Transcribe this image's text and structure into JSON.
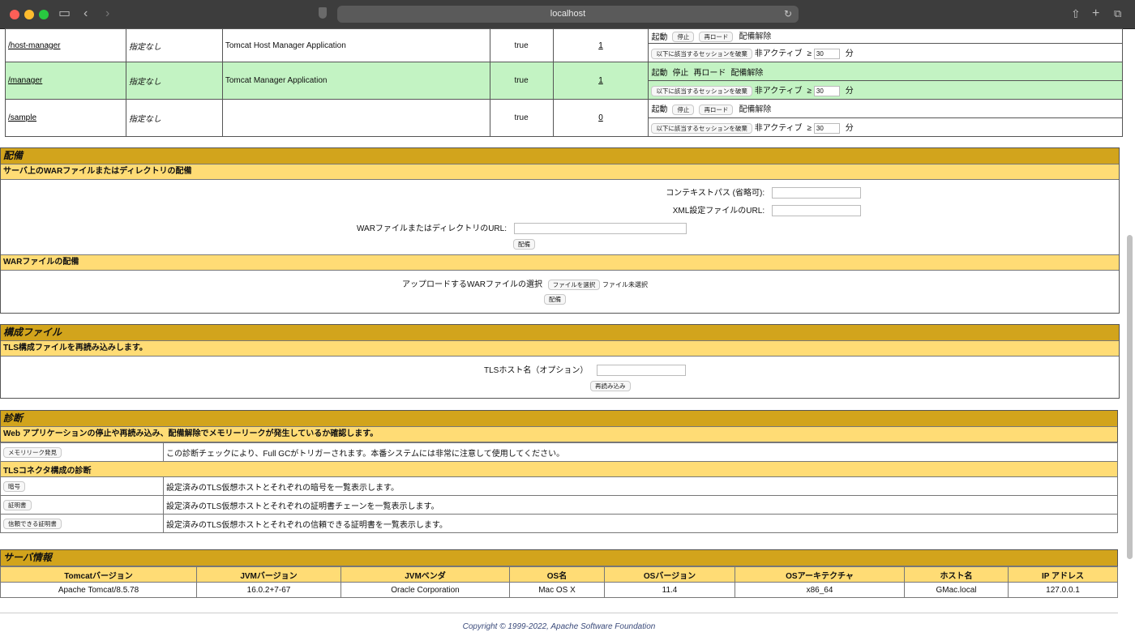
{
  "browser": {
    "address": "localhost"
  },
  "apps": {
    "rows": [
      {
        "path": "/host-manager",
        "version": "指定なし",
        "name": "Tomcat Host Manager Application",
        "running": "true",
        "sessions": "1",
        "highlight": false
      },
      {
        "path": "/manager",
        "version": "指定なし",
        "name": "Tomcat Manager Application",
        "running": "true",
        "sessions": "1",
        "highlight": true
      },
      {
        "path": "/sample",
        "version": "指定なし",
        "name": "",
        "running": "true",
        "sessions": "0",
        "highlight": false
      }
    ],
    "cmd_start": "起動",
    "cmd_stop": "停止",
    "cmd_reload": "再ロード",
    "cmd_undeploy": "配備解除",
    "expire_button": "以下に該当するセッションを破棄",
    "idle_label": "非アクティブ",
    "ge": "≥",
    "idle_value": "30",
    "minutes": "分"
  },
  "deploy": {
    "title": "配備",
    "server_subtitle": "サーバ上のWARファイルまたはディレクトリの配備",
    "context_path_label": "コンテキストパス (省略可):",
    "xml_url_label": "XML設定ファイルのURL:",
    "war_url_label": "WARファイルまたはディレクトリのURL:",
    "deploy_button": "配備",
    "war_subtitle": "WARファイルの配備",
    "upload_label": "アップロードするWARファイルの選択",
    "choose_file_button": "ファイルを選択",
    "no_file": "ファイル未選択",
    "upload_deploy_button": "配備"
  },
  "config": {
    "title": "構成ファイル",
    "subtitle": "TLS構成ファイルを再読み込みします。",
    "host_label": "TLSホスト名（オプション）",
    "reload_button": "再読み込み"
  },
  "diagnostics": {
    "title": "診断",
    "subtitle": "Web アプリケーションの停止や再読み込み、配備解除でメモリーリークが発生しているか確認します。",
    "leak_button": "メモリリーク発見",
    "leak_desc": "この診断チェックにより、Full GCがトリガーされます。本番システムには非常に注意して使用してください。",
    "tls_subtitle": "TLSコネクタ構成の診断",
    "ciphers_button": "暗号",
    "ciphers_desc": "設定済みのTLS仮想ホストとそれぞれの暗号を一覧表示します。",
    "certs_button": "証明書",
    "certs_desc": "設定済みのTLS仮想ホストとそれぞれの証明書チェーンを一覧表示します。",
    "trusted_button": "信頼できる証明書",
    "trusted_desc": "設定済みのTLS仮想ホストとそれぞれの信頼できる証明書を一覧表示します。"
  },
  "server": {
    "title": "サーバ情報",
    "headers": [
      "Tomcatバージョン",
      "JVMバージョン",
      "JVMベンダ",
      "OS名",
      "OSバージョン",
      "OSアーキテクチャ",
      "ホスト名",
      "IP アドレス"
    ],
    "values": [
      "Apache Tomcat/8.5.78",
      "16.0.2+7-67",
      "Oracle Corporation",
      "Mac OS X",
      "11.4",
      "x86_64",
      "GMac.local",
      "127.0.0.1"
    ]
  },
  "footer": "Copyright © 1999-2022, Apache Software Foundation",
  "colors": {
    "section": "#d2a41c",
    "subsection": "#ffdc75",
    "highlight_row": "#c3f3c3"
  }
}
